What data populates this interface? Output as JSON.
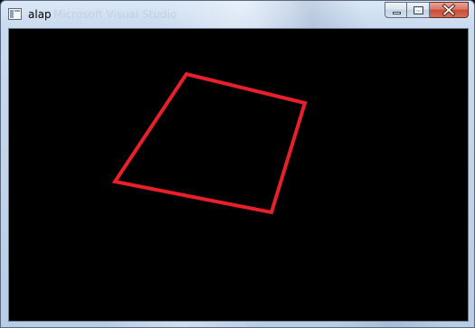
{
  "window": {
    "title": "alap",
    "ghost_title": "Microsoft Visual Studio",
    "icon": "app-window-icon",
    "buttons": [
      {
        "name": "minimize",
        "icon": "minimize-icon"
      },
      {
        "name": "maximize",
        "icon": "maximize-icon"
      },
      {
        "name": "close",
        "icon": "close-icon"
      }
    ]
  },
  "canvas": {
    "background_color": "#000000",
    "shape": {
      "type": "quadrilateral",
      "stroke_color": "#e8202a"
    }
  }
}
